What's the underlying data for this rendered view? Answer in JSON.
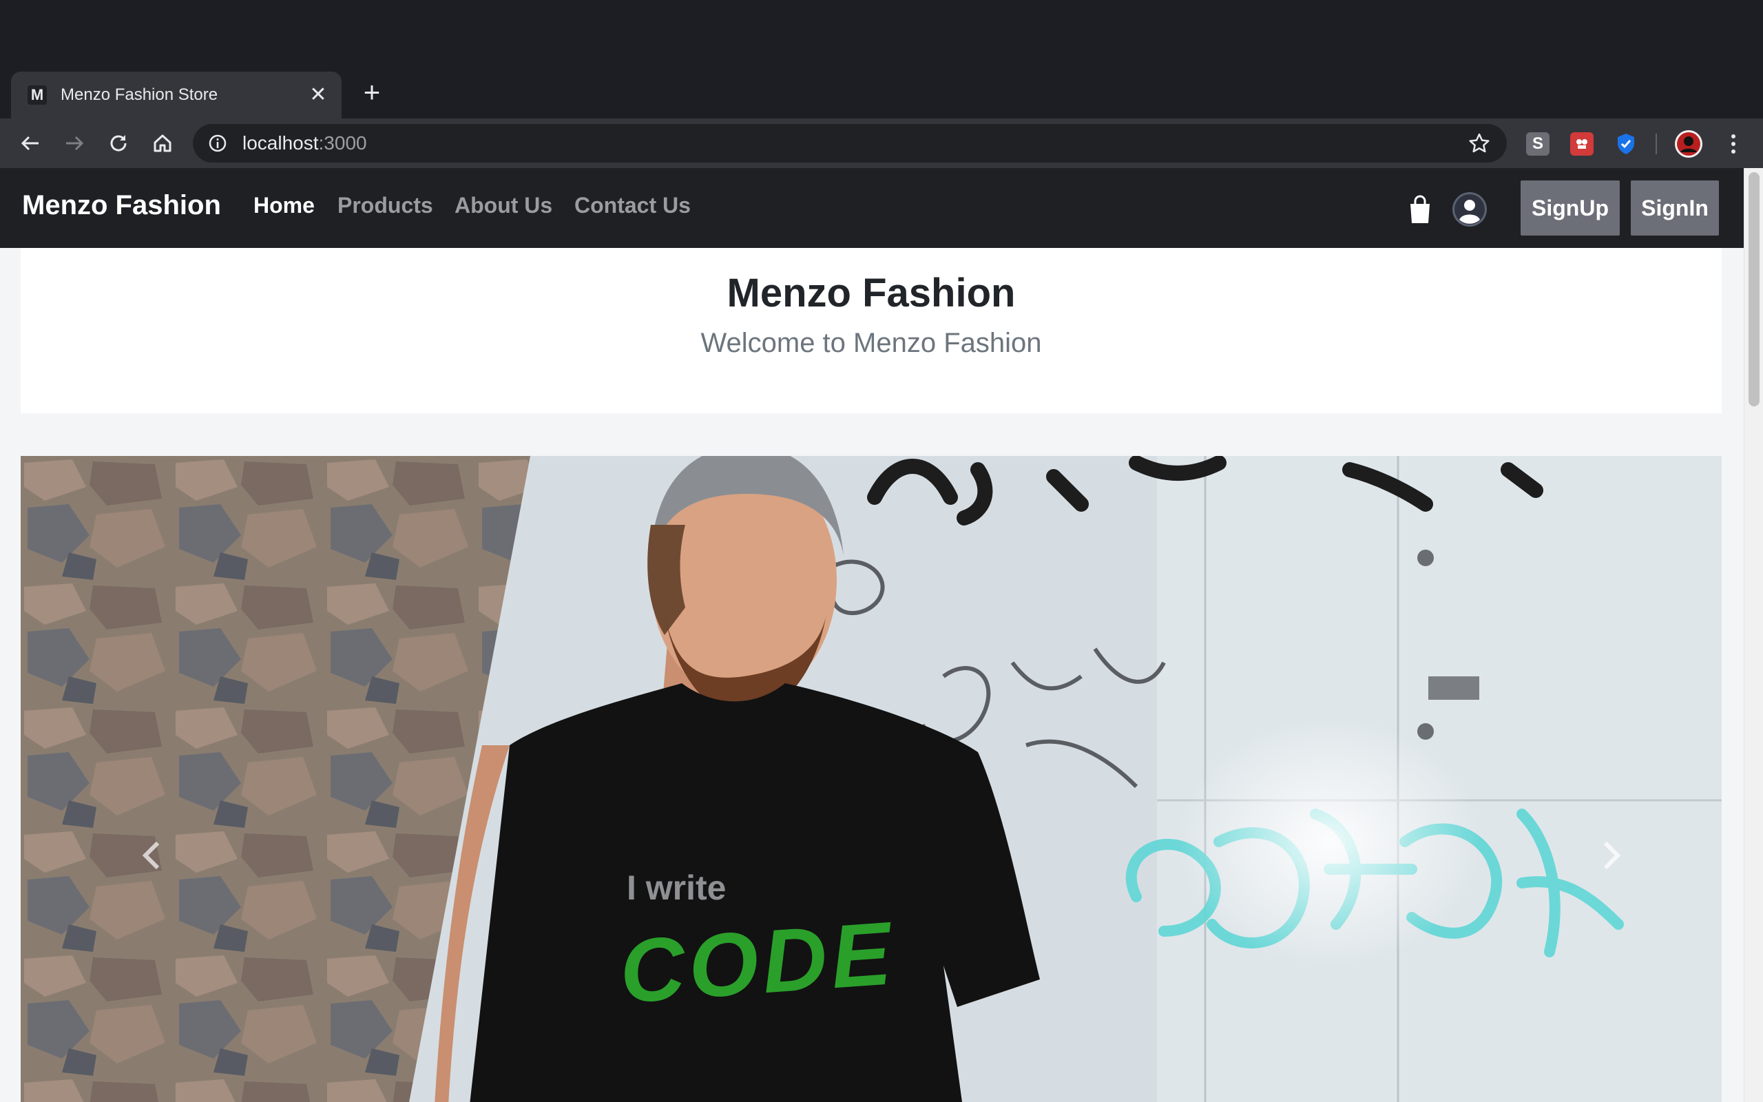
{
  "browser": {
    "tab_title": "Menzo Fashion Store",
    "tab_favicon": "M",
    "close_glyph": "✕",
    "new_tab_glyph": "+",
    "url_host": "localhost",
    "url_port": ":3000",
    "extensions": [
      "s-extension-icon",
      "red-extension-icon",
      "shield-extension-icon",
      "profile-avatar-icon"
    ]
  },
  "navbar": {
    "brand": "Menzo Fashion",
    "links": [
      {
        "label": "Home",
        "active": true
      },
      {
        "label": "Products",
        "active": false
      },
      {
        "label": "About Us",
        "active": false
      },
      {
        "label": "Contact Us",
        "active": false
      }
    ],
    "signup_label": "SignUp",
    "signin_label": "SignIn"
  },
  "hero": {
    "title": "Menzo Fashion",
    "subtitle": "Welcome to Menzo Fashion"
  },
  "carousel": {
    "shirt_line1": "I write",
    "shirt_line2": "CODE",
    "prev_icon": "chevron-left-icon",
    "next_icon": "chevron-right-icon"
  },
  "colors": {
    "navbar_bg": "#1f2023",
    "nav_button_bg": "#6c6f78",
    "code_green": "#2aa02a",
    "graffiti_cyan": "#5fd6d6"
  }
}
